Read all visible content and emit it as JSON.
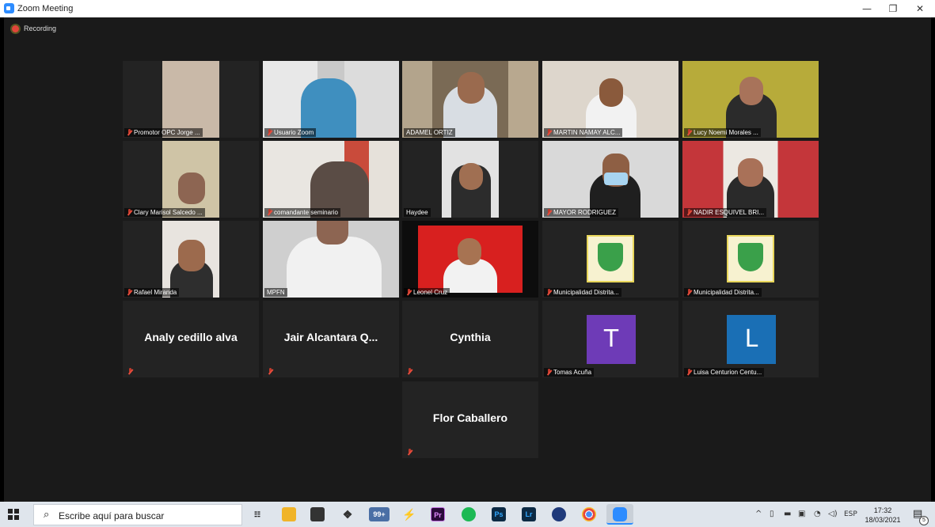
{
  "window": {
    "title": "Zoom Meeting",
    "minimize": "—",
    "restore": "❐",
    "close": "✕"
  },
  "recording": {
    "label": "Recording"
  },
  "participants": [
    {
      "name": "Promotor OPC Jorge ...",
      "muted": true
    },
    {
      "name": "Usuario Zoom",
      "muted": true
    },
    {
      "name": "ADAMEL ORTIZ",
      "muted": false,
      "active": true
    },
    {
      "name": "MARTIN NAMAY ALC...",
      "muted": true
    },
    {
      "name": "Lucy Noemi Morales ...",
      "muted": true
    },
    {
      "name": "Clary Marisol Salcedo ...",
      "muted": true
    },
    {
      "name": "comandante seminario",
      "muted": true
    },
    {
      "name": "Haydee",
      "muted": false
    },
    {
      "name": "MAYOR RODRIGUEZ",
      "muted": true
    },
    {
      "name": "NADIR ESQUIVEL BRI...",
      "muted": true
    },
    {
      "name": "Rafael Miranda",
      "muted": true
    },
    {
      "name": "MPFN",
      "muted": false
    },
    {
      "name": "Leonel Cruz",
      "muted": true
    },
    {
      "name": "Municipalidad Distrita...",
      "muted": true
    },
    {
      "name": "Municipalidad Distrita...",
      "muted": true
    },
    {
      "name": "Analy cedillo alva",
      "muted": true,
      "video": false
    },
    {
      "name": "Jair  Alcantara  Q...",
      "muted": true,
      "video": false
    },
    {
      "name": "Cynthia",
      "muted": true,
      "video": false
    },
    {
      "name": "Tomas Acuña",
      "muted": true,
      "avatar_letter": "T",
      "avatar_color": "#6e3bb7"
    },
    {
      "name": "Luisa Centurion Centu...",
      "muted": true,
      "avatar_letter": "L",
      "avatar_color": "#1a6fb5"
    },
    {
      "name": "Flor Caballero",
      "muted": true,
      "video": false
    }
  ],
  "taskbar": {
    "search_placeholder": "Escribe aquí para buscar",
    "apps": [
      {
        "icon": "task-view-icon",
        "label": "",
        "color": "#dfe5ec"
      },
      {
        "icon": "file-explorer-icon",
        "label": "",
        "color": "#f0b429"
      },
      {
        "icon": "store-icon",
        "label": "",
        "color": "#333333"
      },
      {
        "icon": "dropbox-icon",
        "label": "",
        "color": "#333333"
      },
      {
        "icon": "cloud-icon",
        "label": "99+",
        "color": "#4a6fa5"
      },
      {
        "icon": "power-automate-icon",
        "label": "",
        "color": "#1c8fd8"
      },
      {
        "icon": "premiere-icon",
        "label": "Pr",
        "color": "#2a0a3a"
      },
      {
        "icon": "spotify-icon",
        "label": "",
        "color": "#1db954"
      },
      {
        "icon": "photoshop-icon",
        "label": "Ps",
        "color": "#0c2a44"
      },
      {
        "icon": "lightroom-icon",
        "label": "Lr",
        "color": "#0c2a44"
      },
      {
        "icon": "app-icon",
        "label": "",
        "color": "#1f3a7a"
      },
      {
        "icon": "chrome-icon",
        "label": "",
        "color": "#e8453c"
      },
      {
        "icon": "zoom-icon",
        "label": "",
        "color": "#2d8cff"
      }
    ],
    "tray": {
      "chevron": "^",
      "language": "ESP",
      "time": "17:32",
      "date": "18/03/2021",
      "notifications": "5"
    }
  }
}
